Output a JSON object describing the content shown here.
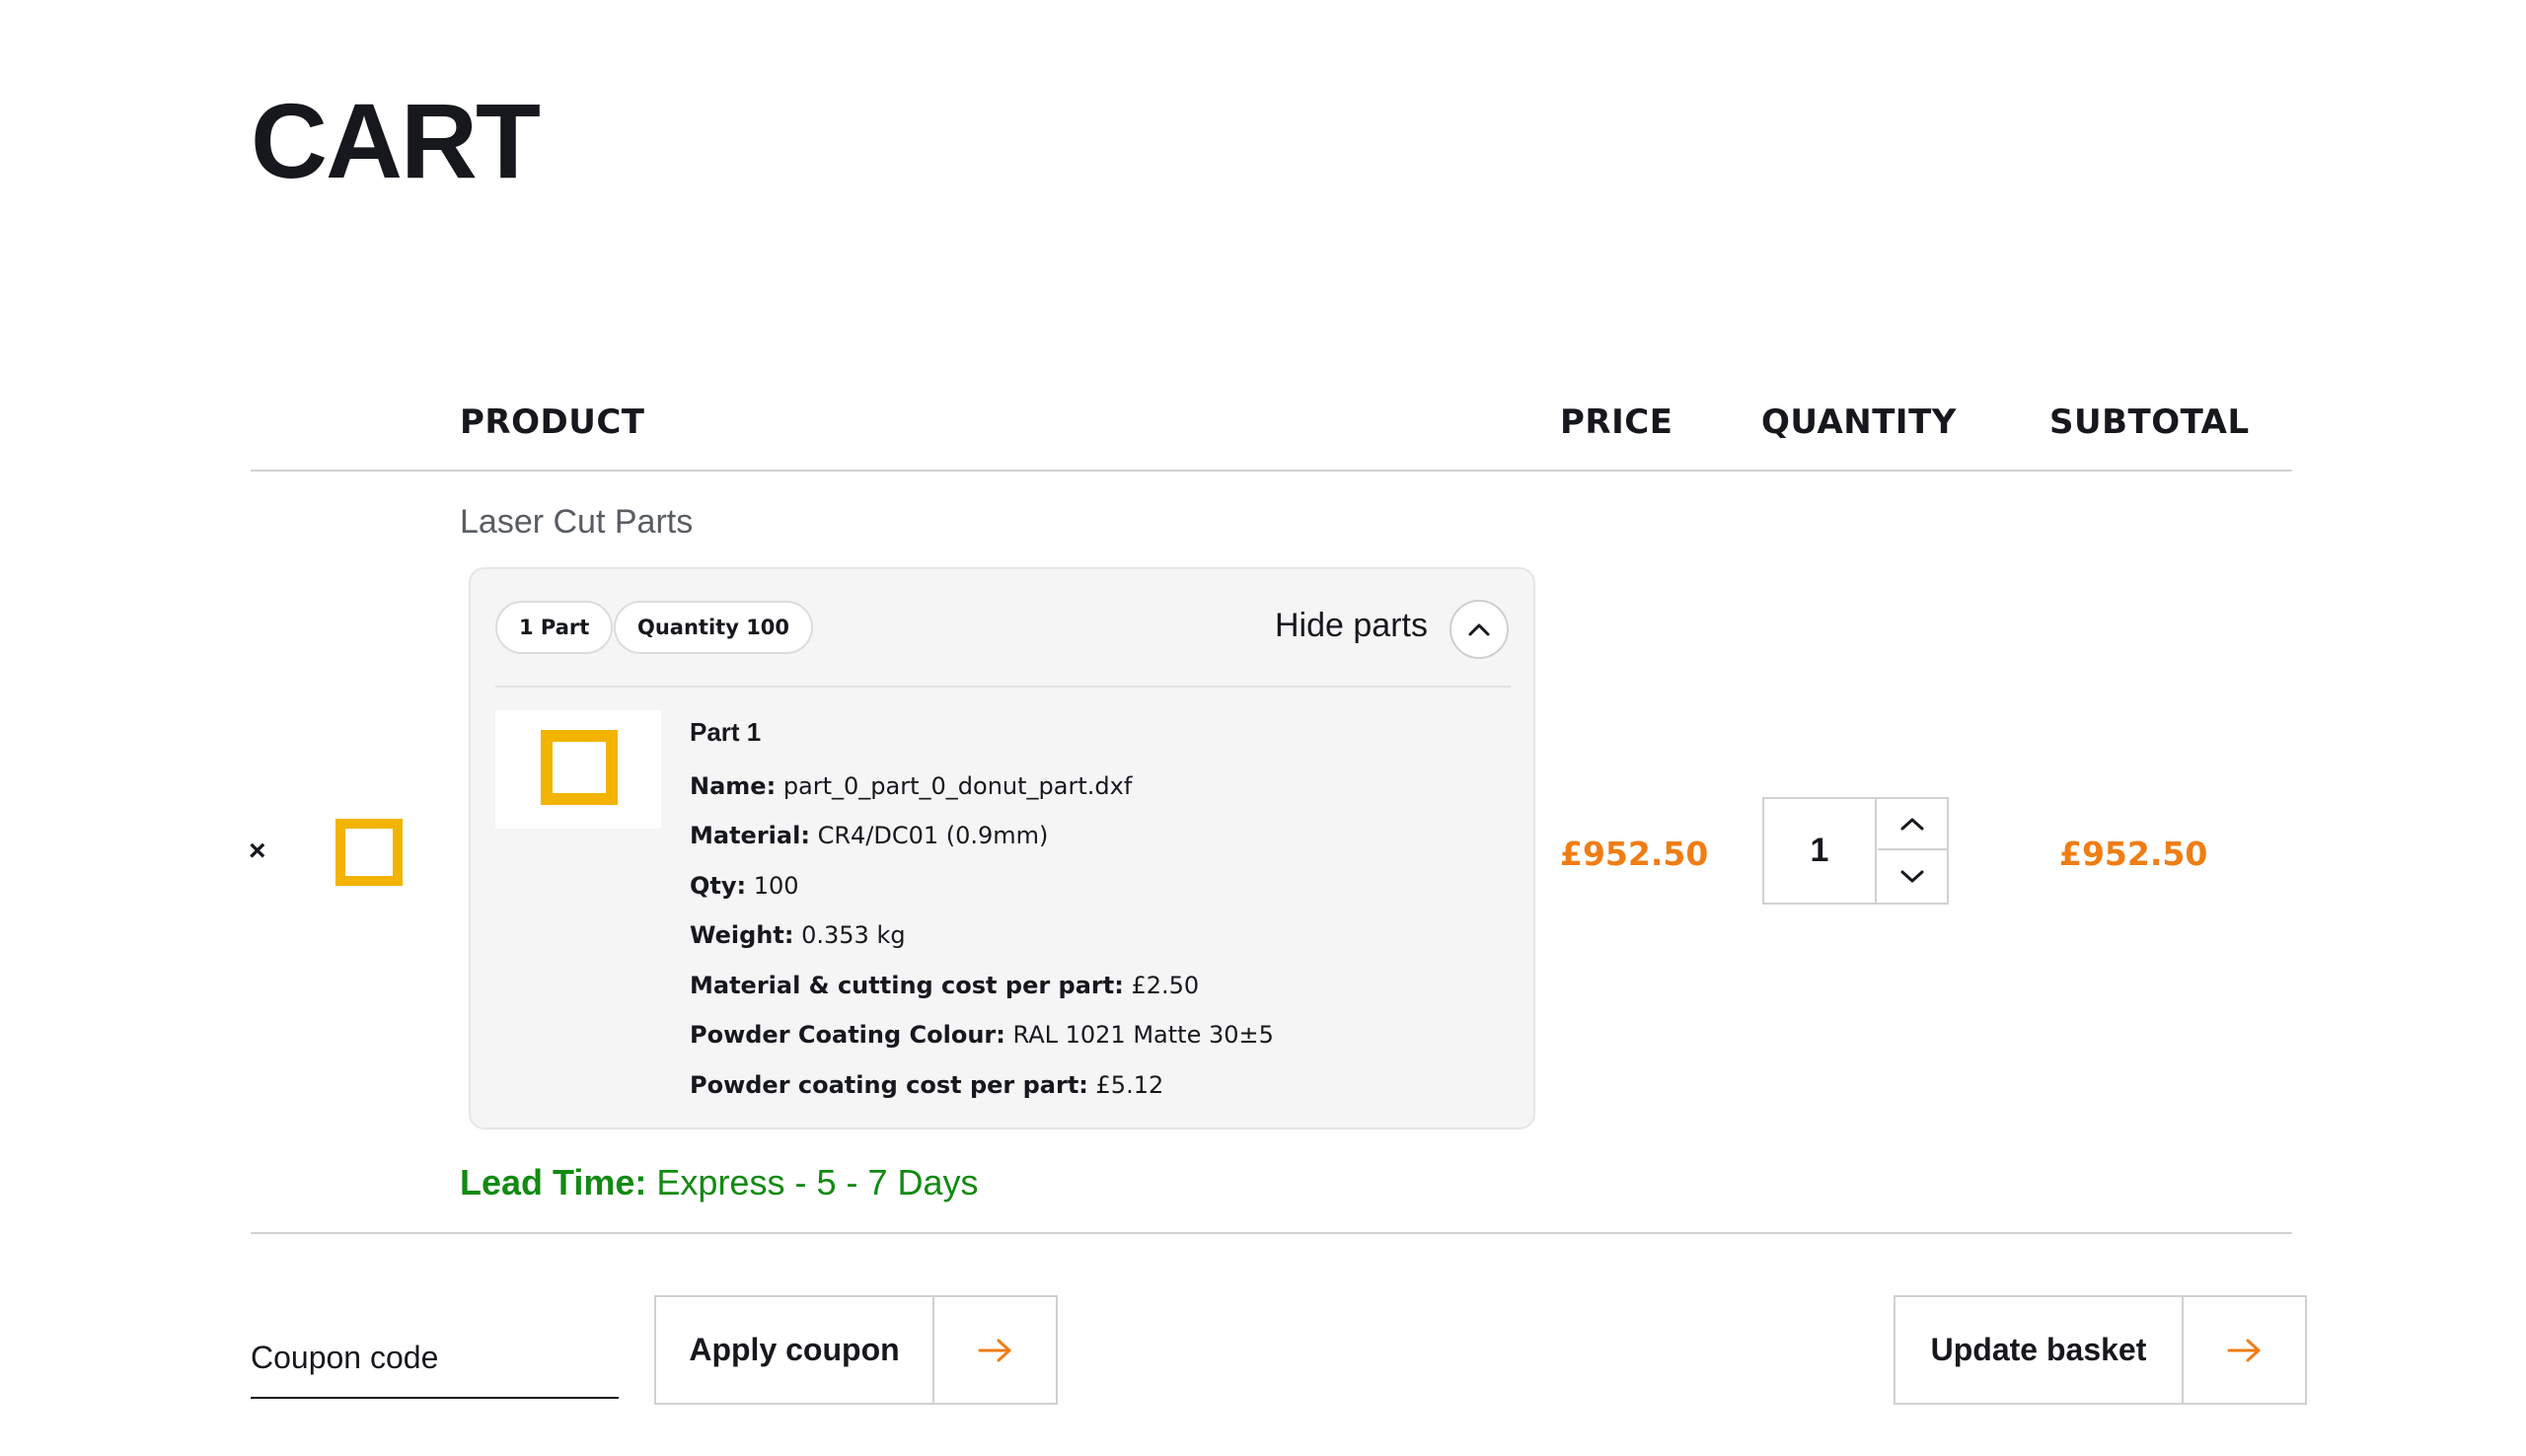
{
  "page": {
    "title": "CART"
  },
  "table": {
    "headers": {
      "product": "PRODUCT",
      "price": "PRICE",
      "quantity": "QUANTITY",
      "subtotal": "SUBTOTAL"
    }
  },
  "item": {
    "remove_label": "×",
    "category": "Laser Cut Parts",
    "chips": {
      "parts": "1 Part",
      "quantity": "Quantity 100"
    },
    "toggle_label": "Hide parts",
    "part": {
      "title": "Part 1",
      "specs": [
        {
          "label": "Name:",
          "value": "part_0_part_0_donut_part.dxf"
        },
        {
          "label": "Material:",
          "value": "CR4/DC01 (0.9mm)"
        },
        {
          "label": "Qty:",
          "value": "100"
        },
        {
          "label": "Weight:",
          "value": "0.353 kg"
        },
        {
          "label": "Material & cutting cost per part:",
          "value": "£2.50"
        },
        {
          "label": "Powder Coating Colour:",
          "value": "RAL 1021 Matte 30±5"
        },
        {
          "label": "Powder coating cost per part:",
          "value": "£5.12"
        }
      ]
    },
    "lead_time": {
      "label": "Lead Time:",
      "value": "Express - 5 - 7 Days"
    },
    "price": "£952.50",
    "quantity": "1",
    "subtotal": "£952.50"
  },
  "actions": {
    "coupon_placeholder": "Coupon code",
    "apply_label": "Apply coupon",
    "update_label": "Update basket"
  },
  "colors": {
    "accent": "#f07d14",
    "thumb": "#f2b400",
    "lead_time": "#128a12"
  },
  "icons": {
    "toggle": "chevron-up-icon",
    "qty_up": "chevron-up-icon",
    "qty_down": "chevron-down-icon",
    "action_arrow": "arrow-right-icon"
  }
}
